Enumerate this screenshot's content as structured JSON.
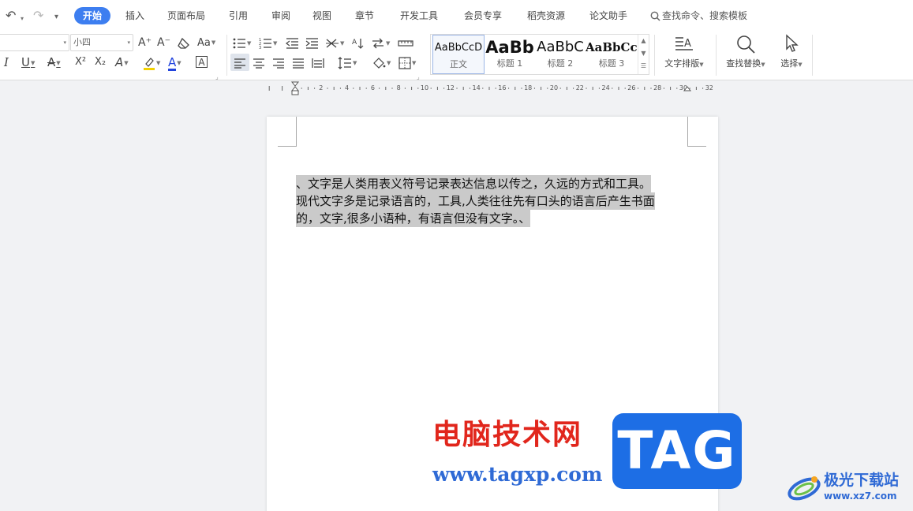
{
  "quick_access": {
    "undo": "↶",
    "redo": "↷",
    "more": "▾"
  },
  "tabs": [
    "开始",
    "插入",
    "页面布局",
    "引用",
    "审阅",
    "视图",
    "章节",
    "开发工具",
    "会员专享",
    "稻壳资源",
    "论文助手"
  ],
  "active_tab_index": 0,
  "search": {
    "label": "查找命令、搜索模板"
  },
  "ribbon": {
    "font_size": "小四",
    "grow_font": "A⁺",
    "shrink_font": "A⁻",
    "change_case": "Aa",
    "italic": "I",
    "underline": "U",
    "strikethrough": "A",
    "superscript": "X²",
    "subscript": "X₂",
    "text_effect": "A",
    "font_color": "A",
    "char_border": "A",
    "styles": [
      {
        "sample": "AaBbCcD",
        "caption": "正文"
      },
      {
        "sample": "AaBb",
        "caption": "标题 1"
      },
      {
        "sample": "AaBbC",
        "caption": "标题 2"
      },
      {
        "sample": "AaBbCcI",
        "caption": "标题 3"
      }
    ],
    "text_layout": "文字排版",
    "find_replace": "查找替换",
    "select": "选择"
  },
  "ruler": {
    "labels": [
      "2",
      "4",
      "6",
      "8",
      "10",
      "12",
      "14",
      "16",
      "18",
      "20",
      "22",
      "24",
      "26",
      "28",
      "30",
      "32"
    ]
  },
  "document": {
    "lines": [
      "、文字是人类用表义符号记录表达信息以传之，久远的方式和工具。",
      "现代文字多是记录语言的，工具,人类往往先有口头的语言后产生书面",
      "的，文字,很多小语种，有语言但没有文字。、"
    ],
    "selected": true
  },
  "watermarks": {
    "site_cn": "电脑技术网",
    "site_url": "www.tagxp.com",
    "tag": "TAG",
    "logo_name": "极光下载站",
    "logo_url": "www.xz7.com"
  },
  "colors": {
    "accent": "#3d7ef0",
    "highlight": "#cacaca",
    "font_color_bar": "#2244dd",
    "highlight_bar": "#f2d100",
    "watermark_red": "#e1261c",
    "watermark_blue": "#2f6ad5"
  }
}
